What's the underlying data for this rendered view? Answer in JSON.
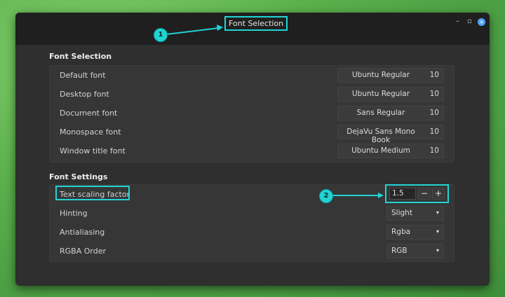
{
  "window": {
    "title": "Font Selection",
    "controls": {
      "minimize": "–",
      "maximize": "▫",
      "close": "×"
    }
  },
  "font_selection": {
    "heading": "Font Selection",
    "rows": [
      {
        "label": "Default font",
        "font": "Ubuntu Regular",
        "size": "10"
      },
      {
        "label": "Desktop font",
        "font": "Ubuntu Regular",
        "size": "10"
      },
      {
        "label": "Document font",
        "font": "Sans Regular",
        "size": "10"
      },
      {
        "label": "Monospace font",
        "font": "DejaVu Sans Mono Book",
        "size": "10"
      },
      {
        "label": "Window title font",
        "font": "Ubuntu Medium",
        "size": "10"
      }
    ]
  },
  "font_settings": {
    "heading": "Font Settings",
    "scaling": {
      "label": "Text scaling factor",
      "value": "1.5",
      "minus": "−",
      "plus": "+"
    },
    "hinting": {
      "label": "Hinting",
      "value": "Slight"
    },
    "antialiasing": {
      "label": "Antialiasing",
      "value": "Rgba"
    },
    "rgba_order": {
      "label": "RGBA Order",
      "value": "RGB"
    }
  },
  "annotations": {
    "callout1": "1",
    "callout2": "2",
    "color": "#22d3d3"
  },
  "icons": {
    "dropdown": "▾"
  }
}
